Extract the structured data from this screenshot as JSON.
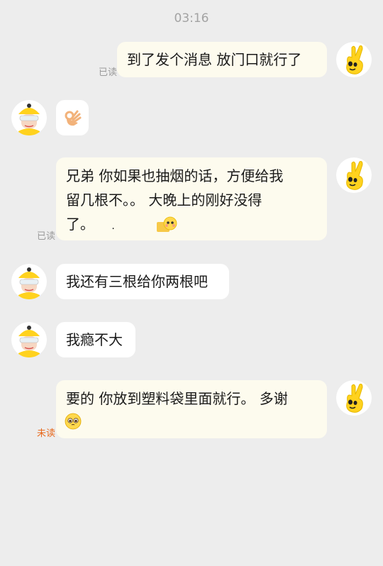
{
  "chat": {
    "timestamp": "03:16",
    "messages": [
      {
        "direction": "outgoing",
        "text": "到了发个消息 放门口就行了",
        "receipt": "已读"
      },
      {
        "direction": "incoming",
        "emoji": "ok-hand-emoji"
      },
      {
        "direction": "outgoing",
        "line1": "兄弟 你如果也抽烟的话，方便给我",
        "line2": "留几根不。。 大晚上的刚好没得",
        "line3": "了。",
        "dot": ".",
        "receipt": "已读",
        "emoji": "shy-face-emoji"
      },
      {
        "direction": "incoming",
        "text": "我还有三根给你两根吧"
      },
      {
        "direction": "incoming",
        "text": "我瘾不大"
      },
      {
        "direction": "outgoing",
        "line1": "要的 你放到塑料袋里面就行。 多谢",
        "receipt": "未读",
        "emoji": "pleading-face-emoji"
      }
    ]
  },
  "colors": {
    "background": "#ededed",
    "outgoing_bubble": "#fdfbee",
    "incoming_bubble": "#ffffff",
    "read_receipt": "#9a9a9a",
    "unread_receipt": "#e8681a",
    "avatar_yellow": "#ffd21e"
  }
}
